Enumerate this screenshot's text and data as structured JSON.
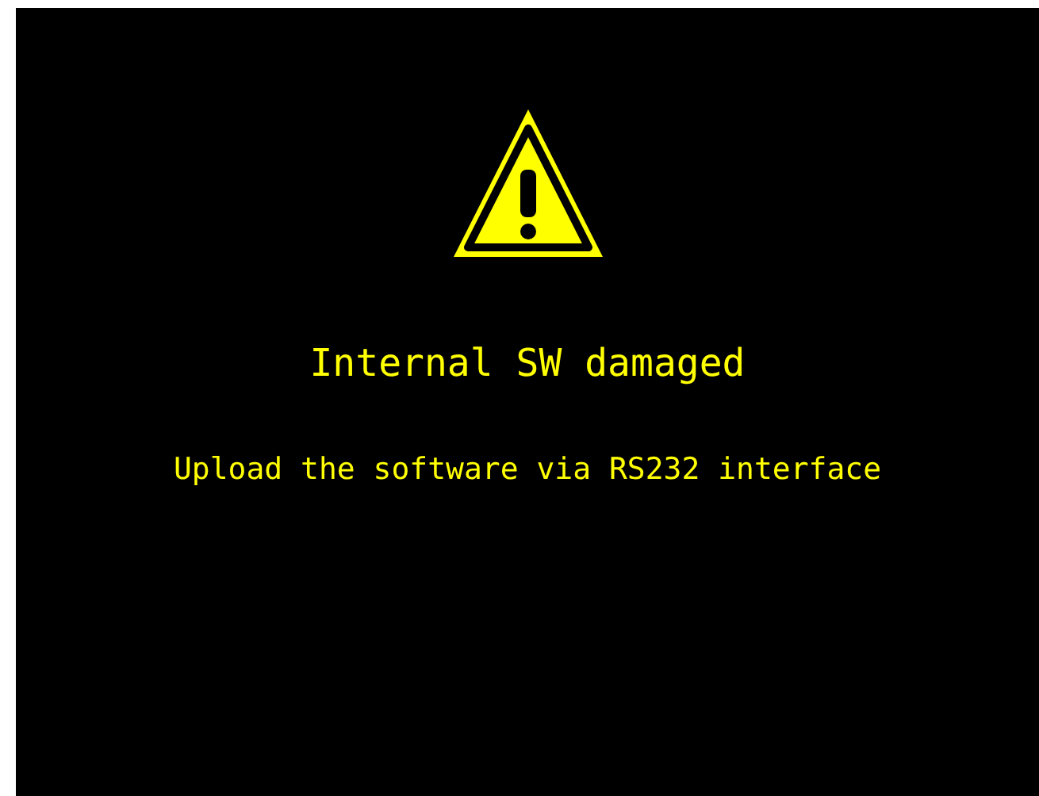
{
  "screen": {
    "title": "Internal SW damaged",
    "message": "Upload the software via RS232 interface"
  }
}
